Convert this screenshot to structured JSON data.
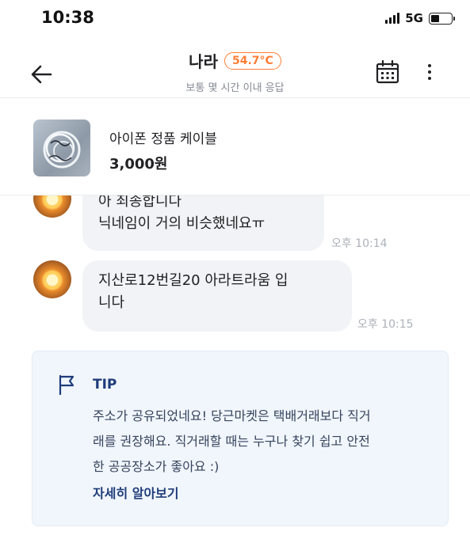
{
  "status_bar": {
    "time": "10:38",
    "network": "5G",
    "icons": [
      "cellular-signal-icon",
      "battery-icon"
    ]
  },
  "header": {
    "seller_name": "나라",
    "manner_temp": "54.7°C",
    "response_time": "보통 몇 시간 이내 응답",
    "icons": [
      "back-arrow-icon",
      "calendar-icon",
      "more-vertical-icon"
    ],
    "accent_color": "#ff7e36"
  },
  "product": {
    "title": "아이폰 정품 케이블",
    "price": "3,000원"
  },
  "messages": [
    {
      "lines": [
        "아 죄송합니다",
        "닉네임이 거의 비슷했네요ㅠ"
      ],
      "time": "오후 10:14"
    },
    {
      "lines": [
        "지산로12번길20 아라트라움 입",
        "니다"
      ],
      "time": "오후 10:15"
    }
  ],
  "tip": {
    "label": "TIP",
    "lines": [
      "주소가 공유되었네요! 당근마켓은 택배거래보다 직거",
      "래를 권장해요. 직거래할 때는 누구나 찾기 쉽고 안전",
      "한 공공장소가 좋아요 :)"
    ],
    "link": "자세히 알아보기",
    "icon": "flag-icon",
    "accent_color": "#1f3c7a"
  }
}
